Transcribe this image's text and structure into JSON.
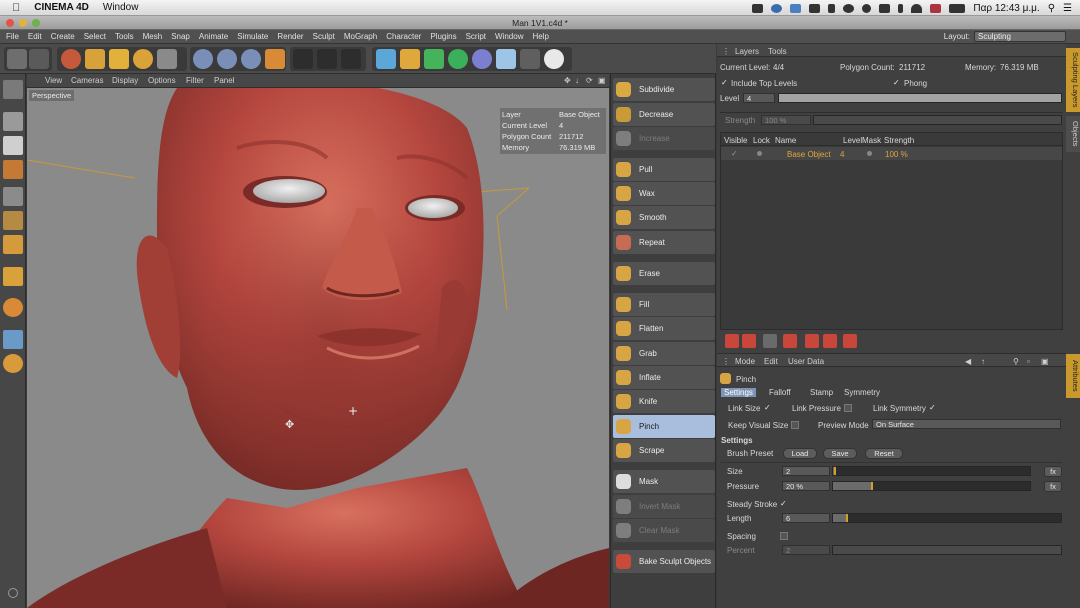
{
  "mac_menu": {
    "app": "CINEMA 4D",
    "window": "Window",
    "clock": "Παρ 12:43 μ.μ.",
    "status_icons": [
      "camera-icon",
      "globe-icon",
      "dropbox-icon",
      "cloud-icon",
      "user-icon",
      "time-machine-icon",
      "sync-icon",
      "display-icon",
      "bluetooth-icon",
      "wifi-icon",
      "flag-icon",
      "battery-icon"
    ]
  },
  "window": {
    "title": "Man 1V1.c4d *"
  },
  "menubar": {
    "items": [
      "File",
      "Edit",
      "Create",
      "Select",
      "Tools",
      "Mesh",
      "Snap",
      "Animate",
      "Simulate",
      "Render",
      "Sculpt",
      "MoGraph",
      "Character",
      "Plugins",
      "Script",
      "Window",
      "Help"
    ],
    "layout_label": "Layout:",
    "layout_value": "Sculpting"
  },
  "viewport": {
    "menu": [
      "View",
      "Cameras",
      "Display",
      "Options",
      "Filter",
      "Panel"
    ],
    "label": "Perspective",
    "hud": [
      {
        "k": "Layer",
        "v": "Base Object"
      },
      {
        "k": "Current Level",
        "v": "4"
      },
      {
        "k": "Polygon Count",
        "v": "211712"
      },
      {
        "k": "Memory",
        "v": "76.319 MB"
      }
    ]
  },
  "sculpt_tools": [
    {
      "name": "subdivide",
      "label": "Subdivide",
      "state": "normal",
      "color": "#d9aa42"
    },
    {
      "name": "decrease",
      "label": "Decrease",
      "state": "normal",
      "color": "#c99a38"
    },
    {
      "name": "increase",
      "label": "Increase",
      "state": "dim",
      "color": "#7e7e7e"
    },
    {
      "name": "pull",
      "label": "Pull",
      "state": "normal",
      "color": "#d8a545"
    },
    {
      "name": "wax",
      "label": "Wax",
      "state": "normal",
      "color": "#d8a545"
    },
    {
      "name": "smooth",
      "label": "Smooth",
      "state": "normal",
      "color": "#d8a545"
    },
    {
      "name": "repeat",
      "label": "Repeat",
      "state": "normal",
      "color": "#c86b55"
    },
    {
      "name": "erase",
      "label": "Erase",
      "state": "normal",
      "color": "#d8a545"
    },
    {
      "name": "fill",
      "label": "Fill",
      "state": "normal",
      "color": "#d8a545"
    },
    {
      "name": "flatten",
      "label": "Flatten",
      "state": "normal",
      "color": "#d8a545"
    },
    {
      "name": "grab",
      "label": "Grab",
      "state": "normal",
      "color": "#d8a545"
    },
    {
      "name": "inflate",
      "label": "Inflate",
      "state": "normal",
      "color": "#d8a545"
    },
    {
      "name": "knife",
      "label": "Knife",
      "state": "normal",
      "color": "#d8a545"
    },
    {
      "name": "pinch",
      "label": "Pinch",
      "state": "active",
      "color": "#d8a545"
    },
    {
      "name": "scrape",
      "label": "Scrape",
      "state": "normal",
      "color": "#d8a545"
    },
    {
      "name": "mask",
      "label": "Mask",
      "state": "normal",
      "color": "#dddddd"
    },
    {
      "name": "invert-mask",
      "label": "Invert Mask",
      "state": "dim",
      "color": "#7e7e7e"
    },
    {
      "name": "clear-mask",
      "label": "Clear Mask",
      "state": "dim",
      "color": "#7e7e7e"
    },
    {
      "name": "bake-sculpt-objects",
      "label": "Bake Sculpt Objects",
      "state": "normal",
      "color": "#c84a3a"
    }
  ],
  "layers": {
    "tabs": [
      "Layers",
      "Tools"
    ],
    "current_level_label": "Current Level:",
    "current_level": "4/4",
    "polygon_count_label": "Polygon Count:",
    "polygon_count": "211712",
    "memory_label": "Memory:",
    "memory": "76.319 MB",
    "include_top_levels": "Include Top Levels",
    "phong": "Phong",
    "level_label": "Level",
    "level_value": "4",
    "level_fraction": 1.0,
    "strength_label": "Strength",
    "strength_value": "100 %",
    "columns": [
      "Visible",
      "Lock",
      "Name",
      "Level",
      "Mask",
      "Strength"
    ],
    "rows": [
      {
        "name": "Base Object",
        "level": "4",
        "strength": "100 %"
      }
    ]
  },
  "attributes": {
    "menu": [
      "Mode",
      "Edit",
      "User Data"
    ],
    "tool": "Pinch",
    "tabs": [
      "Settings",
      "Falloff",
      "Stamp",
      "Symmetry"
    ],
    "link_size": "Link Size",
    "link_pressure": "Link Pressure",
    "link_symmetry": "Link Symmetry",
    "keep_visual_size": "Keep Visual Size",
    "preview_mode_label": "Preview Mode",
    "preview_mode_value": "On Surface",
    "section": "Settings",
    "brush_preset": "Brush Preset",
    "load": "Load",
    "save": "Save",
    "reset": "Reset",
    "size_label": "Size",
    "size_value": "2",
    "size_fraction": 0.01,
    "pressure_label": "Pressure",
    "pressure_value": "20 %",
    "pressure_fraction": 0.2,
    "fx": "fx",
    "steady_stroke": "Steady Stroke",
    "length_label": "Length",
    "length_value": "6",
    "length_fraction": 0.06,
    "spacing_label": "Spacing",
    "percent_label": "Percent",
    "percent_value": "2"
  },
  "side_tabs": [
    "Sculpting Layers",
    "Objects",
    "Attributes"
  ],
  "colors": {
    "accent": "#c99a2b",
    "selection": "#a9bedc",
    "skin": "#b5473f"
  }
}
